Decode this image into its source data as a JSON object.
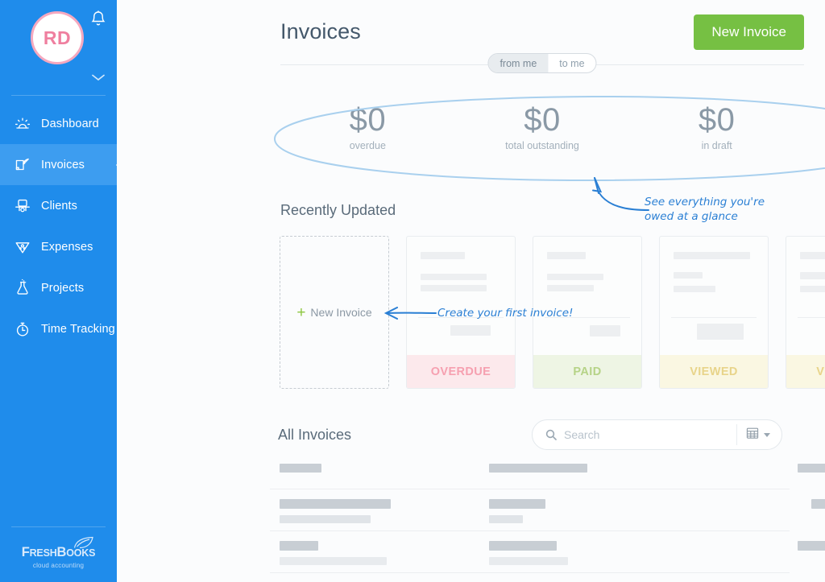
{
  "sidebar": {
    "avatar_initials": "RD",
    "bell_icon": "bell-icon",
    "chevron_icon": "chevron-down-icon",
    "items": [
      {
        "label": "Dashboard",
        "icon": "dashboard-sun-icon",
        "active": false
      },
      {
        "label": "Invoices",
        "icon": "invoice-quill-icon",
        "active": true
      },
      {
        "label": "Clients",
        "icon": "clients-icon",
        "active": false
      },
      {
        "label": "Expenses",
        "icon": "expenses-pie-icon",
        "active": false
      },
      {
        "label": "Projects",
        "icon": "projects-flask-icon",
        "active": false
      },
      {
        "label": "Time Tracking",
        "icon": "stopwatch-icon",
        "active": false
      }
    ],
    "logo": {
      "part1": "F",
      "part2": "RESH",
      "part3": "B",
      "part4": "OOKS",
      "tagline": "cloud accounting"
    }
  },
  "header": {
    "title": "Invoices",
    "new_invoice_button": "New Invoice",
    "toggle": {
      "from": "from me",
      "to": "to me",
      "selected": "from me"
    }
  },
  "summary": {
    "cells": [
      {
        "value": "$0",
        "label": "overdue"
      },
      {
        "value": "$0",
        "label": "total outstanding"
      },
      {
        "value": "$0",
        "label": "in draft"
      }
    ]
  },
  "annotations": {
    "summary_note_line1": "See everything you're",
    "summary_note_line2": "owed at a glance",
    "new_invoice_note": "Create your first invoice!"
  },
  "recent": {
    "section_title": "Recently Updated",
    "new_card": {
      "plus": "+",
      "label": "New Invoice"
    },
    "cards": [
      {
        "status": "OVERDUE",
        "status_class": "overdue"
      },
      {
        "status": "PAID",
        "status_class": "paid"
      },
      {
        "status": "VIEWED",
        "status_class": "viewed"
      },
      {
        "status": "VIEWED",
        "status_class": "viewed"
      }
    ]
  },
  "all_invoices": {
    "section_title": "All Invoices",
    "search_placeholder": "Search",
    "search_value": "",
    "search_icon": "search-icon",
    "view_icon": "grid-view-icon",
    "caret_icon": "chevron-down-icon"
  },
  "colors": {
    "sidebar_blue": "#1f8ceb",
    "sidebar_active": "#3d9df0",
    "green_button": "#76c043",
    "annotation_blue": "#2a7fd4",
    "overdue_pink": "#f6a0b0",
    "paid_green": "#b6d387",
    "viewed_yellow": "#e8d48a",
    "avatar_pink": "#ef7f9f"
  }
}
